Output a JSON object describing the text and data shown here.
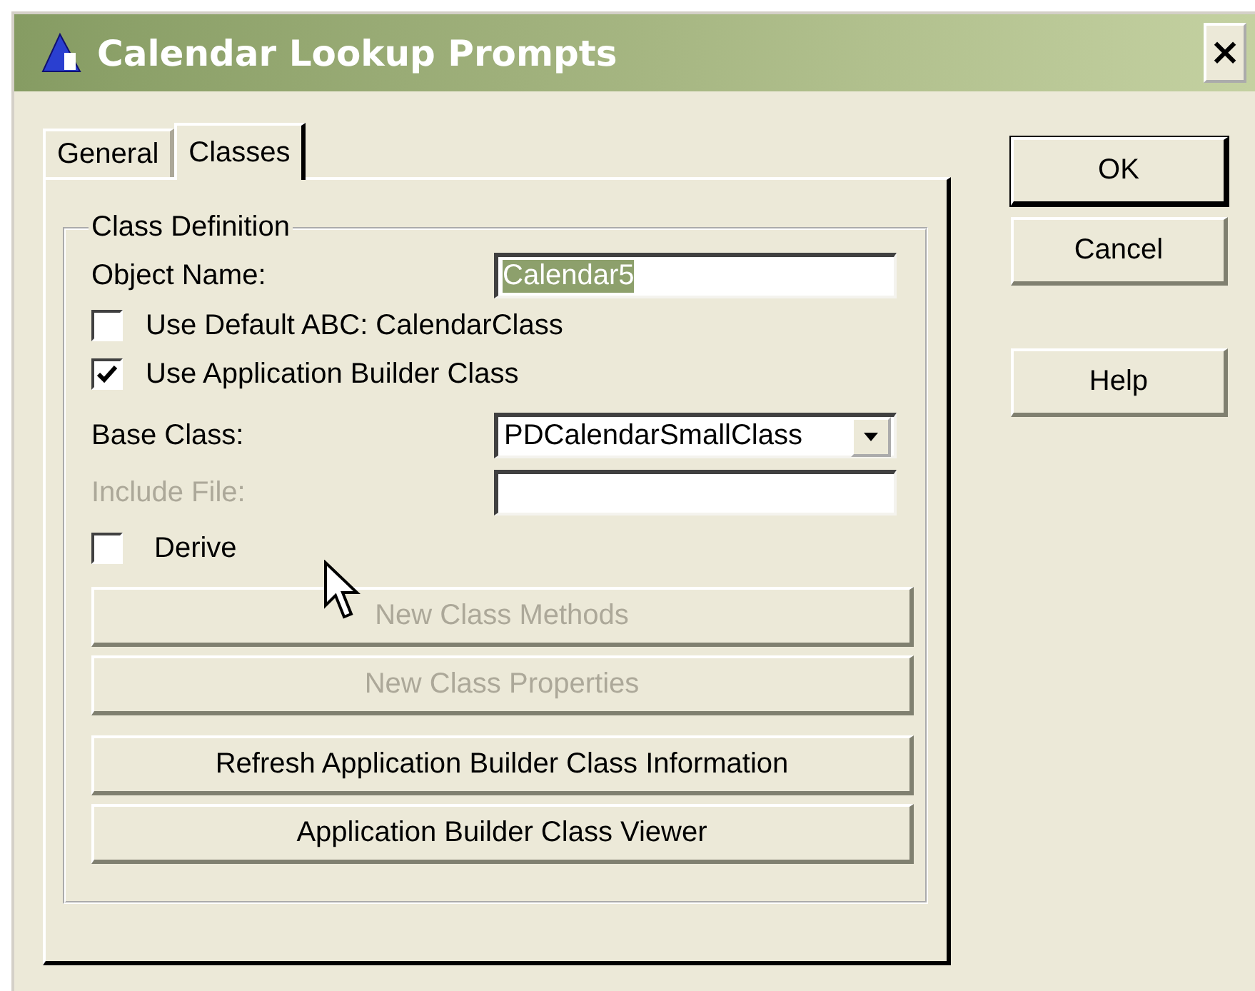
{
  "window": {
    "title": "Calendar Lookup Prompts",
    "close": "×"
  },
  "tabs": [
    {
      "label": "General",
      "selected": false
    },
    {
      "label": "Classes",
      "selected": true
    }
  ],
  "group": {
    "title": "Class Definition",
    "object_name": {
      "label": "Object Name:",
      "value": "Calendar5",
      "value_selected": true
    },
    "checks": [
      {
        "label": "Use Default ABC: CalendarClass",
        "checked": false
      },
      {
        "label": "Use Application Builder Class",
        "checked": true
      }
    ],
    "base_class": {
      "label": "Base Class:",
      "value": "PDCalendarSmallClass"
    },
    "include_file": {
      "label": "Include File:",
      "disabled": true
    },
    "derive": {
      "label": "Derive",
      "checked": false
    },
    "buttons": [
      {
        "label": "New Class Methods",
        "disabled": true
      },
      {
        "label": "New Class Properties",
        "disabled": true
      },
      {
        "label": "Refresh Application Builder Class Information",
        "disabled": false
      },
      {
        "label": "Application Builder Class Viewer",
        "disabled": false
      }
    ]
  },
  "dialog_buttons": [
    {
      "label": "OK",
      "default": true
    },
    {
      "label": "Cancel",
      "default": false
    },
    {
      "label": "Help",
      "default": false
    }
  ]
}
